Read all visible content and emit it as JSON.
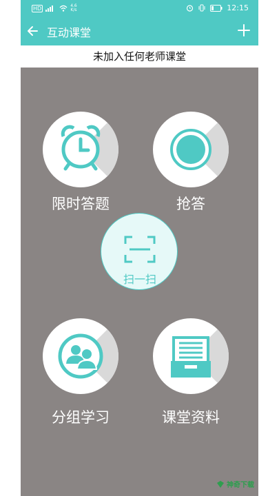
{
  "status_bar": {
    "signal_text": "HD",
    "net_speed_value": "4.6",
    "net_speed_unit": "K/s",
    "time": "12:15"
  },
  "app_bar": {
    "title": "互动课堂"
  },
  "subheader": {
    "text": "未加入任何老师课堂"
  },
  "tiles": [
    {
      "label": "限时答题",
      "icon": "alarm-clock-icon"
    },
    {
      "label": "抢答",
      "icon": "record-circle-icon"
    },
    {
      "label": "分组学习",
      "icon": "group-users-icon"
    },
    {
      "label": "课堂资料",
      "icon": "file-drawer-icon"
    }
  ],
  "scan": {
    "label": "扫一扫",
    "icon": "scan-frame-icon"
  },
  "watermark": {
    "text": "神奇下载"
  },
  "colors": {
    "accent": "#4fc9c4",
    "background": "#8a8584",
    "tile_fill": "#ffffff",
    "tile_shadow": "#d9d9d9"
  }
}
